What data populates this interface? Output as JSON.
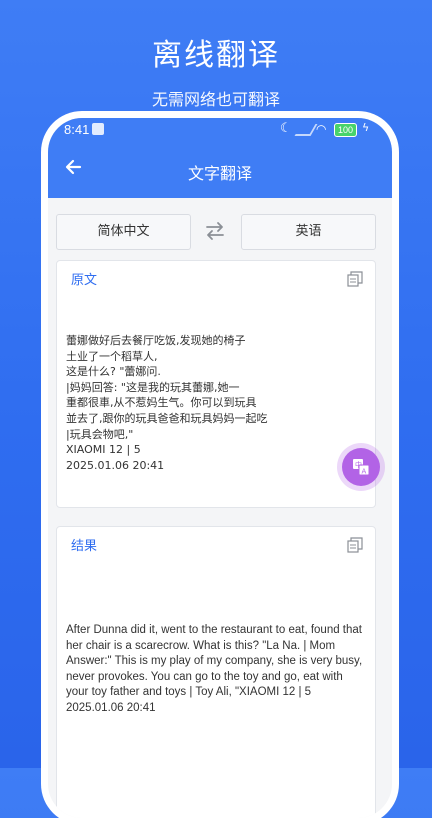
{
  "promo": {
    "title": "离线翻译",
    "subtitle": "无需网络也可翻译"
  },
  "status_bar": {
    "time": "8:41",
    "battery": "100"
  },
  "app_bar": {
    "title": "文字翻译"
  },
  "languages": {
    "source": "简体中文",
    "target": "英语"
  },
  "source_card": {
    "label": "原文",
    "text": "蕾娜做好后去餐厅吃饭,发现她的椅子\n土业了一个稻草人,\n这是什么? \"蕾娜问.\n|妈妈回答: \"这是我的玩其蕾娜,她一\n重都很車,从不惹妈生气。你可以到玩具\n並去了,跟你的玩具爸爸和玩具妈妈一起吃\n|玩具会物吧,\"\nXIAOMI 12 | 5\n2025.01.06 20:41"
  },
  "result_card": {
    "label": "结果",
    "text": "After Dunna did it, went to the restaurant to eat, found that her chair is a scarecrow. What is this? \"La Na. | Mom Answer:\" This is my play of my company, she is very busy, never provokes. You can go to the toy and go, eat with your toy father and toys | Toy Ali, \"XIAOMI 12 | 5\n2025.01.06 20:41"
  },
  "icons": {
    "back": "arrow-left",
    "swap": "swap-arrows",
    "copy": "copy",
    "translate": "translate"
  },
  "colors": {
    "primary": "#3f7df5",
    "accent": "#b263e6"
  }
}
